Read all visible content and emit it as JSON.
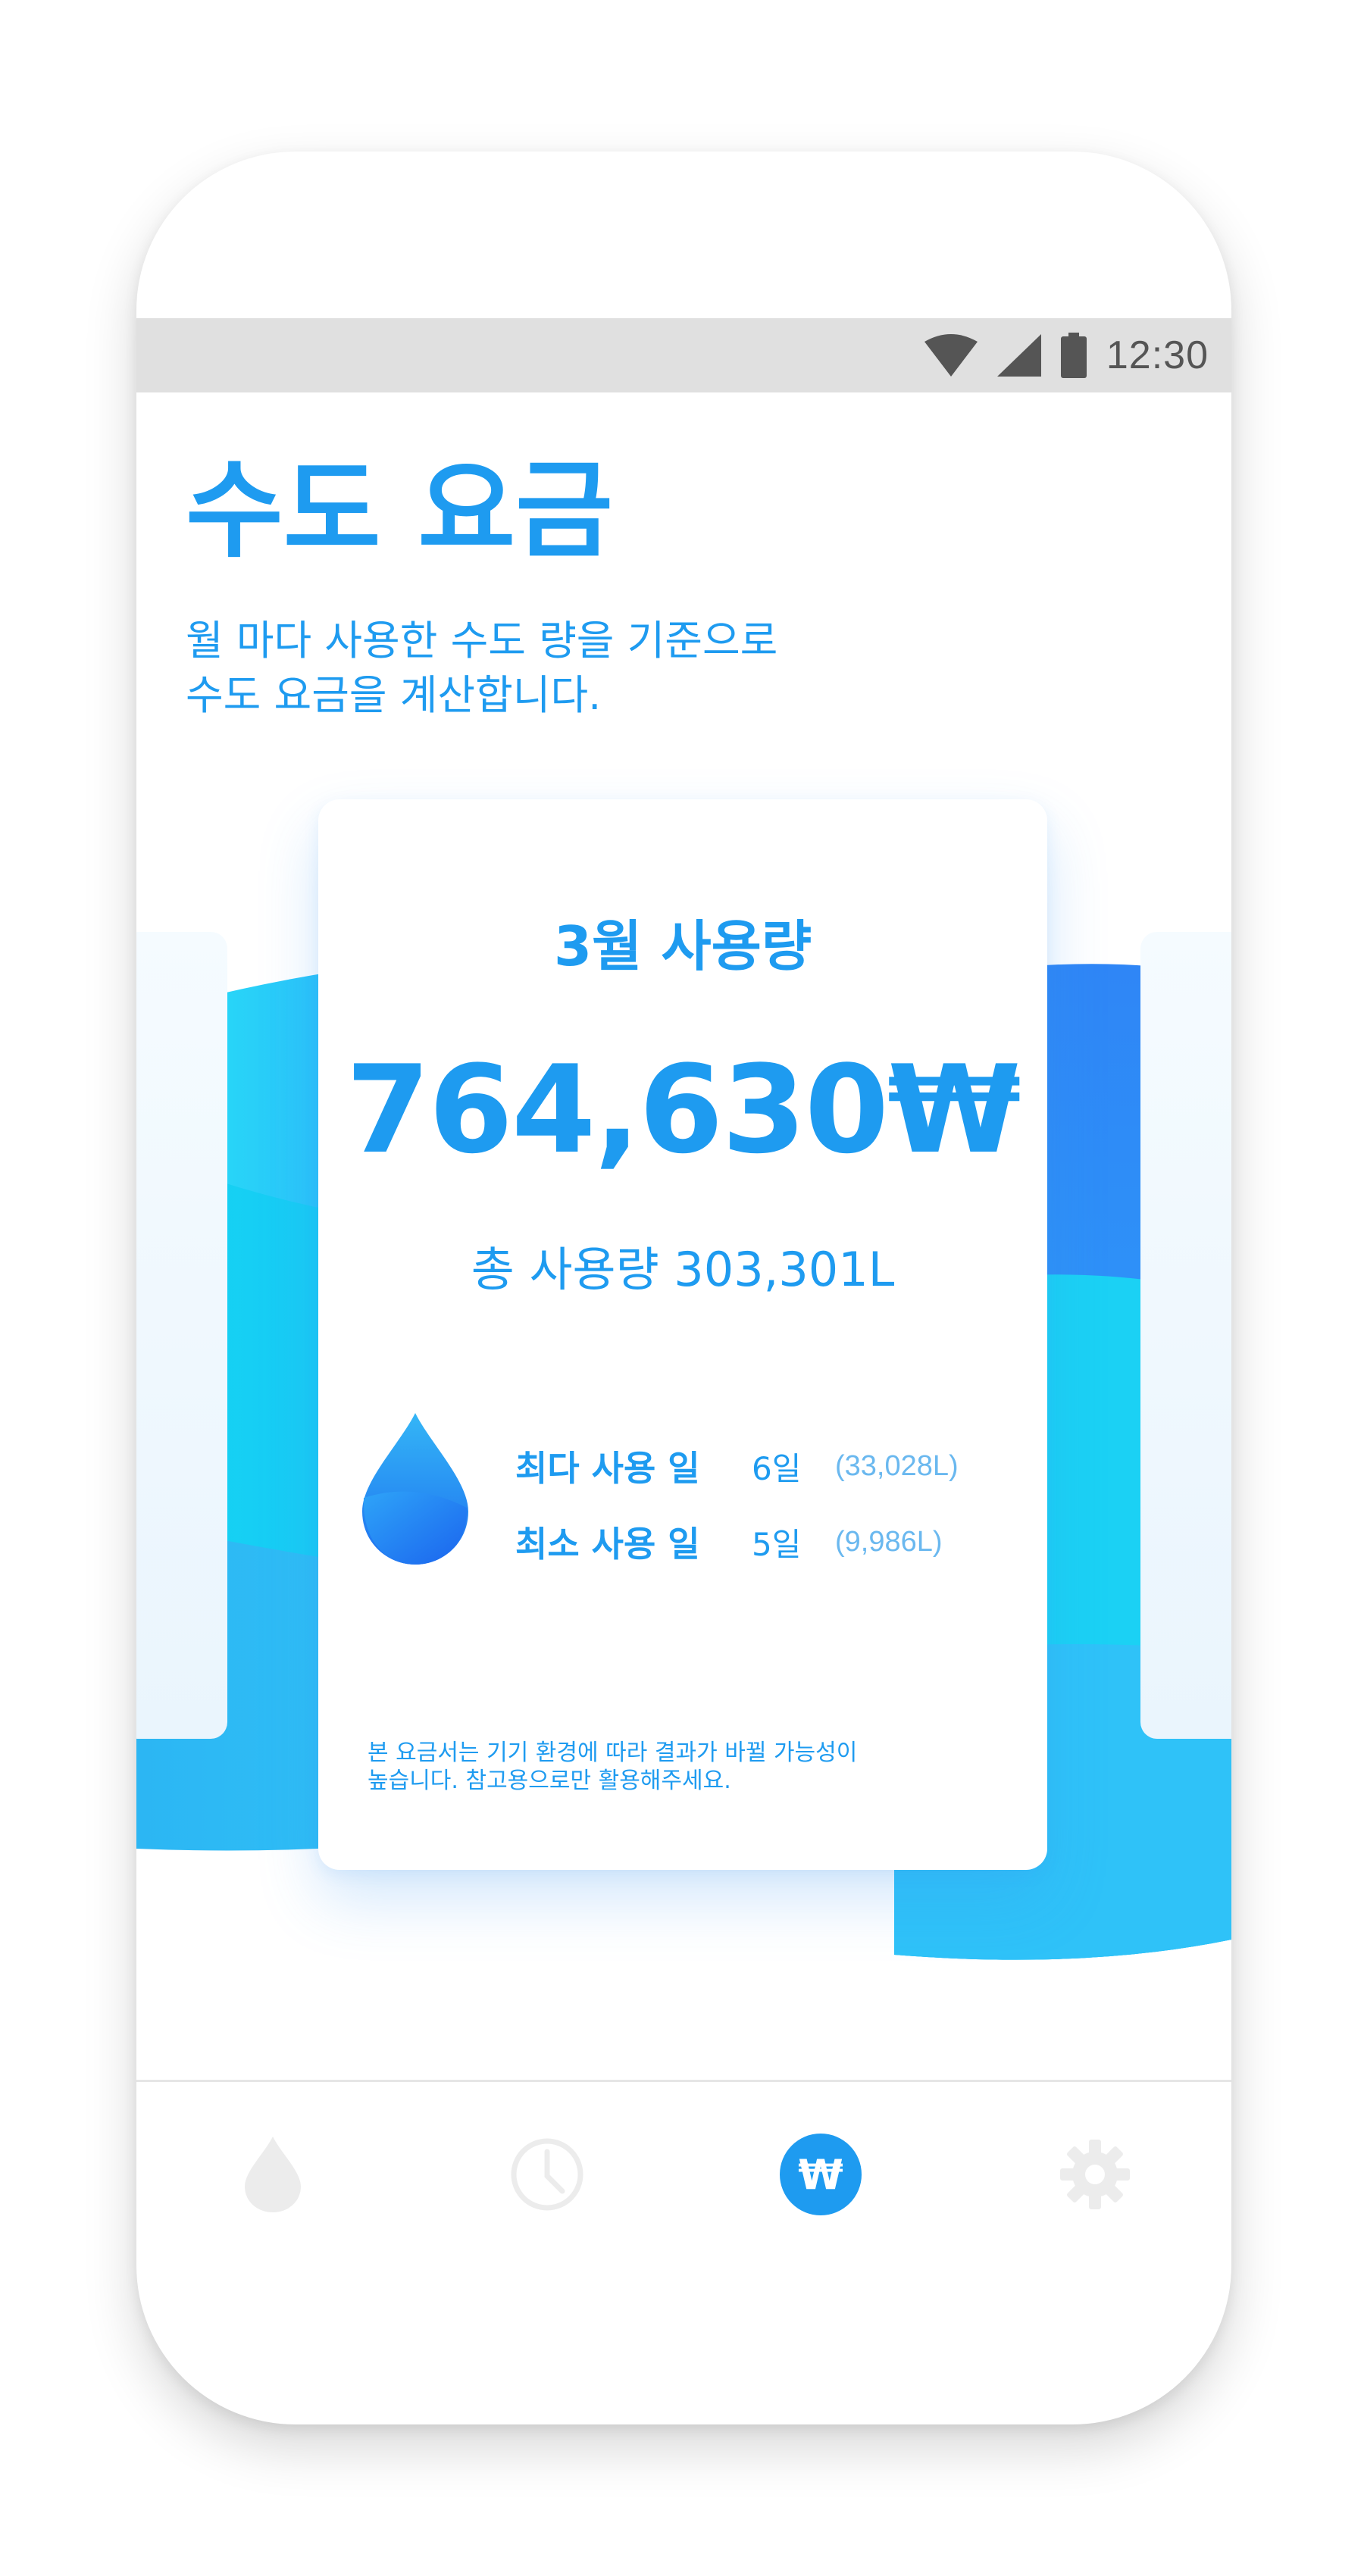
{
  "status_bar": {
    "time": "12:30"
  },
  "header": {
    "title": "수도 요금",
    "subtitle_line1": "월 마다 사용한 수도 량을 기준으로",
    "subtitle_line2": "수도 요금을 계산합니다."
  },
  "card": {
    "month_label": "3월 사용량",
    "amount": "764,630₩",
    "total_usage": "총 사용량 303,301L",
    "stats": [
      {
        "label": "최다 사용 일",
        "day": "6일",
        "detail": "(33,028L)"
      },
      {
        "label": "최소 사용 일",
        "day": "5일",
        "detail": "(9,986L)"
      }
    ],
    "note_line1": "본 요금서는 기기 환경에 따라 결과가 바뀔 가능성이",
    "note_line2": "높습니다. 참고용으로만 활용해주세요."
  },
  "bottom_nav": {
    "items": [
      {
        "icon": "water-drop-icon",
        "active": false
      },
      {
        "icon": "clock-icon",
        "active": false
      },
      {
        "icon": "won-icon",
        "symbol": "₩",
        "active": true
      },
      {
        "icon": "gear-icon",
        "active": false
      }
    ]
  },
  "colors": {
    "primary": "#1e9bf0",
    "inactive_icon": "#ececec",
    "status_bar_bg": "#e0e0e0"
  }
}
